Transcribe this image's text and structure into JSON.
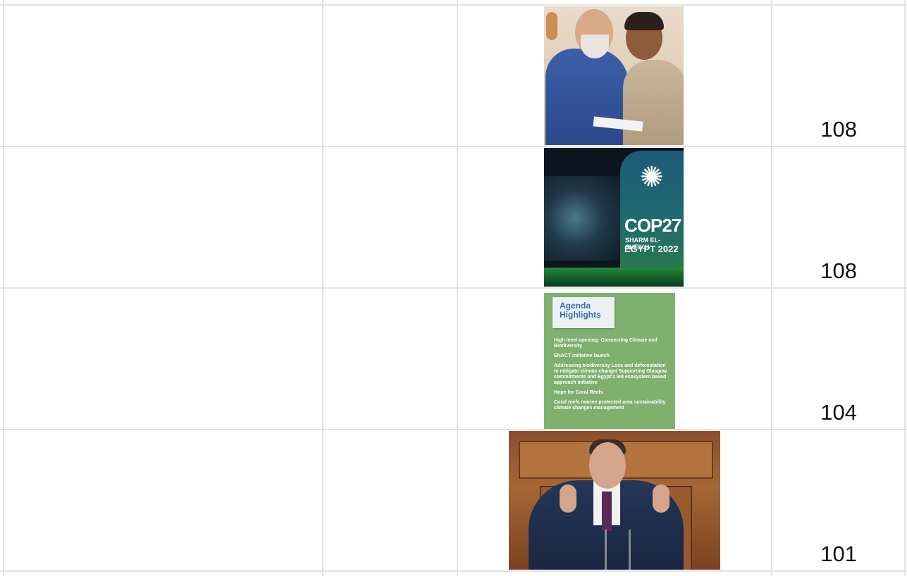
{
  "rows": [
    {
      "value": "108",
      "image": "photo-two-people-holding-document"
    },
    {
      "value": "108",
      "image": "photo-cop27-stage"
    },
    {
      "value": "104",
      "image": "agenda-highlights-card"
    },
    {
      "value": "101",
      "image": "photo-speaker-at-podium"
    }
  ],
  "cop27": {
    "logo_text": "COP27",
    "location": "SHARM EL-SHEIKH",
    "year_line": "EGYPT 2022"
  },
  "agenda": {
    "title": "Agenda Highlights",
    "items": [
      "High level opening: Connecting Climate and Biodiversity",
      "ENACT initiative launch",
      "Addressing biodiversity Loss and deforestation to mitigate climate change/ Supporting Glasgow commitments and Egypt's led ecosystem based approach initiative",
      "Hope for Coral Reefs",
      "Coral reefs marine protected area sustainability climate changes management"
    ]
  },
  "colors": {
    "grid_line": "#e2e2e2",
    "agenda_green": "#7fb06e",
    "agenda_title_blue": "#2e6fb4"
  }
}
